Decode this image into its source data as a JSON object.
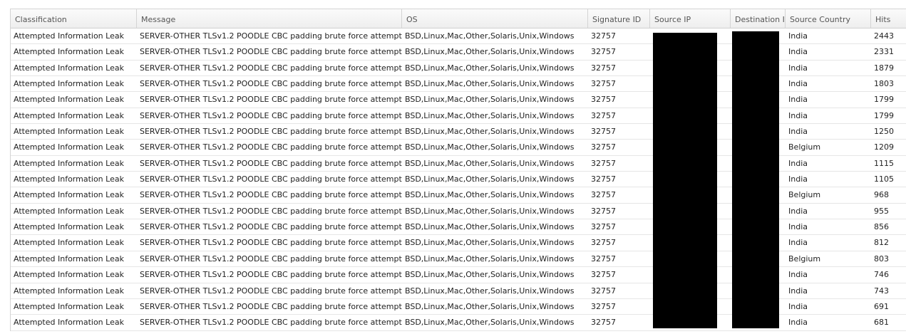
{
  "colors": {
    "header_bg": "#eeeeee",
    "border": "#d4d4d4",
    "row_divider": "#e6e6e6",
    "redaction": "#000000"
  },
  "columns": [
    {
      "key": "classification",
      "label": "Classification"
    },
    {
      "key": "message",
      "label": "Message"
    },
    {
      "key": "os",
      "label": "OS"
    },
    {
      "key": "signature_id",
      "label": "Signature ID"
    },
    {
      "key": "source_ip",
      "label": "Source IP"
    },
    {
      "key": "destination_ip",
      "label": "Destination IP"
    },
    {
      "key": "source_country",
      "label": "Source Country"
    },
    {
      "key": "hits",
      "label": "Hits"
    }
  ],
  "rows": [
    {
      "classification": "Attempted Information Leak",
      "message": "SERVER-OTHER TLSv1.2 POODLE CBC padding brute force attempt",
      "os": "BSD,Linux,Mac,Other,Solaris,Unix,Windows",
      "signature_id": "32757",
      "source_country": "India",
      "hits": "2443"
    },
    {
      "classification": "Attempted Information Leak",
      "message": "SERVER-OTHER TLSv1.2 POODLE CBC padding brute force attempt",
      "os": "BSD,Linux,Mac,Other,Solaris,Unix,Windows",
      "signature_id": "32757",
      "source_country": "India",
      "hits": "2331"
    },
    {
      "classification": "Attempted Information Leak",
      "message": "SERVER-OTHER TLSv1.2 POODLE CBC padding brute force attempt",
      "os": "BSD,Linux,Mac,Other,Solaris,Unix,Windows",
      "signature_id": "32757",
      "source_country": "India",
      "hits": "1879"
    },
    {
      "classification": "Attempted Information Leak",
      "message": "SERVER-OTHER TLSv1.2 POODLE CBC padding brute force attempt",
      "os": "BSD,Linux,Mac,Other,Solaris,Unix,Windows",
      "signature_id": "32757",
      "source_country": "India",
      "hits": "1803"
    },
    {
      "classification": "Attempted Information Leak",
      "message": "SERVER-OTHER TLSv1.2 POODLE CBC padding brute force attempt",
      "os": "BSD,Linux,Mac,Other,Solaris,Unix,Windows",
      "signature_id": "32757",
      "source_country": "India",
      "hits": "1799"
    },
    {
      "classification": "Attempted Information Leak",
      "message": "SERVER-OTHER TLSv1.2 POODLE CBC padding brute force attempt",
      "os": "BSD,Linux,Mac,Other,Solaris,Unix,Windows",
      "signature_id": "32757",
      "source_country": "India",
      "hits": "1799"
    },
    {
      "classification": "Attempted Information Leak",
      "message": "SERVER-OTHER TLSv1.2 POODLE CBC padding brute force attempt",
      "os": "BSD,Linux,Mac,Other,Solaris,Unix,Windows",
      "signature_id": "32757",
      "source_country": "India",
      "hits": "1250"
    },
    {
      "classification": "Attempted Information Leak",
      "message": "SERVER-OTHER TLSv1.2 POODLE CBC padding brute force attempt",
      "os": "BSD,Linux,Mac,Other,Solaris,Unix,Windows",
      "signature_id": "32757",
      "source_country": "Belgium",
      "hits": "1209"
    },
    {
      "classification": "Attempted Information Leak",
      "message": "SERVER-OTHER TLSv1.2 POODLE CBC padding brute force attempt",
      "os": "BSD,Linux,Mac,Other,Solaris,Unix,Windows",
      "signature_id": "32757",
      "source_country": "India",
      "hits": "1115"
    },
    {
      "classification": "Attempted Information Leak",
      "message": "SERVER-OTHER TLSv1.2 POODLE CBC padding brute force attempt",
      "os": "BSD,Linux,Mac,Other,Solaris,Unix,Windows",
      "signature_id": "32757",
      "source_country": "India",
      "hits": "1105"
    },
    {
      "classification": "Attempted Information Leak",
      "message": "SERVER-OTHER TLSv1.2 POODLE CBC padding brute force attempt",
      "os": "BSD,Linux,Mac,Other,Solaris,Unix,Windows",
      "signature_id": "32757",
      "source_country": "Belgium",
      "hits": "968"
    },
    {
      "classification": "Attempted Information Leak",
      "message": "SERVER-OTHER TLSv1.2 POODLE CBC padding brute force attempt",
      "os": "BSD,Linux,Mac,Other,Solaris,Unix,Windows",
      "signature_id": "32757",
      "source_country": "India",
      "hits": "955"
    },
    {
      "classification": "Attempted Information Leak",
      "message": "SERVER-OTHER TLSv1.2 POODLE CBC padding brute force attempt",
      "os": "BSD,Linux,Mac,Other,Solaris,Unix,Windows",
      "signature_id": "32757",
      "source_country": "India",
      "hits": "856"
    },
    {
      "classification": "Attempted Information Leak",
      "message": "SERVER-OTHER TLSv1.2 POODLE CBC padding brute force attempt",
      "os": "BSD,Linux,Mac,Other,Solaris,Unix,Windows",
      "signature_id": "32757",
      "source_country": "India",
      "hits": "812"
    },
    {
      "classification": "Attempted Information Leak",
      "message": "SERVER-OTHER TLSv1.2 POODLE CBC padding brute force attempt",
      "os": "BSD,Linux,Mac,Other,Solaris,Unix,Windows",
      "signature_id": "32757",
      "source_country": "Belgium",
      "hits": "803"
    },
    {
      "classification": "Attempted Information Leak",
      "message": "SERVER-OTHER TLSv1.2 POODLE CBC padding brute force attempt",
      "os": "BSD,Linux,Mac,Other,Solaris,Unix,Windows",
      "signature_id": "32757",
      "source_country": "India",
      "hits": "746"
    },
    {
      "classification": "Attempted Information Leak",
      "message": "SERVER-OTHER TLSv1.2 POODLE CBC padding brute force attempt",
      "os": "BSD,Linux,Mac,Other,Solaris,Unix,Windows",
      "signature_id": "32757",
      "source_country": "India",
      "hits": "743"
    },
    {
      "classification": "Attempted Information Leak",
      "message": "SERVER-OTHER TLSv1.2 POODLE CBC padding brute force attempt",
      "os": "BSD,Linux,Mac,Other,Solaris,Unix,Windows",
      "signature_id": "32757",
      "source_country": "India",
      "hits": "691"
    },
    {
      "classification": "Attempted Information Leak",
      "message": "SERVER-OTHER TLSv1.2 POODLE CBC padding brute force attempt",
      "os": "BSD,Linux,Mac,Other,Solaris,Unix,Windows",
      "signature_id": "32757",
      "source_country": "India",
      "hits": "681"
    }
  ]
}
